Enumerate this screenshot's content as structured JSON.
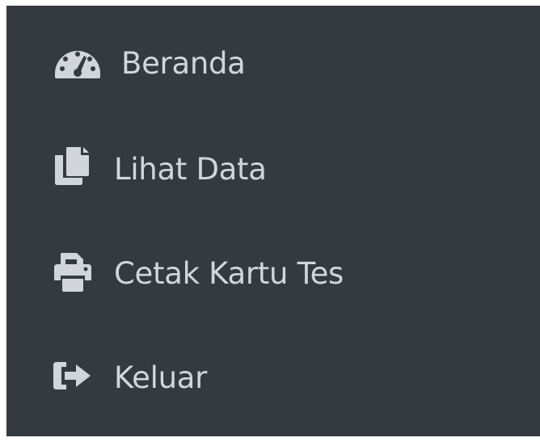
{
  "sidebar": {
    "items": [
      {
        "label": "Beranda",
        "icon": "tachometer-icon"
      },
      {
        "label": "Lihat Data",
        "icon": "copy-files-icon"
      },
      {
        "label": "Cetak Kartu Tes",
        "icon": "printer-icon"
      },
      {
        "label": "Keluar",
        "icon": "sign-out-icon"
      }
    ]
  },
  "colors": {
    "sidebar_bg": "#343a40",
    "text": "#d2d6dc",
    "page_bg": "#ffffff"
  }
}
